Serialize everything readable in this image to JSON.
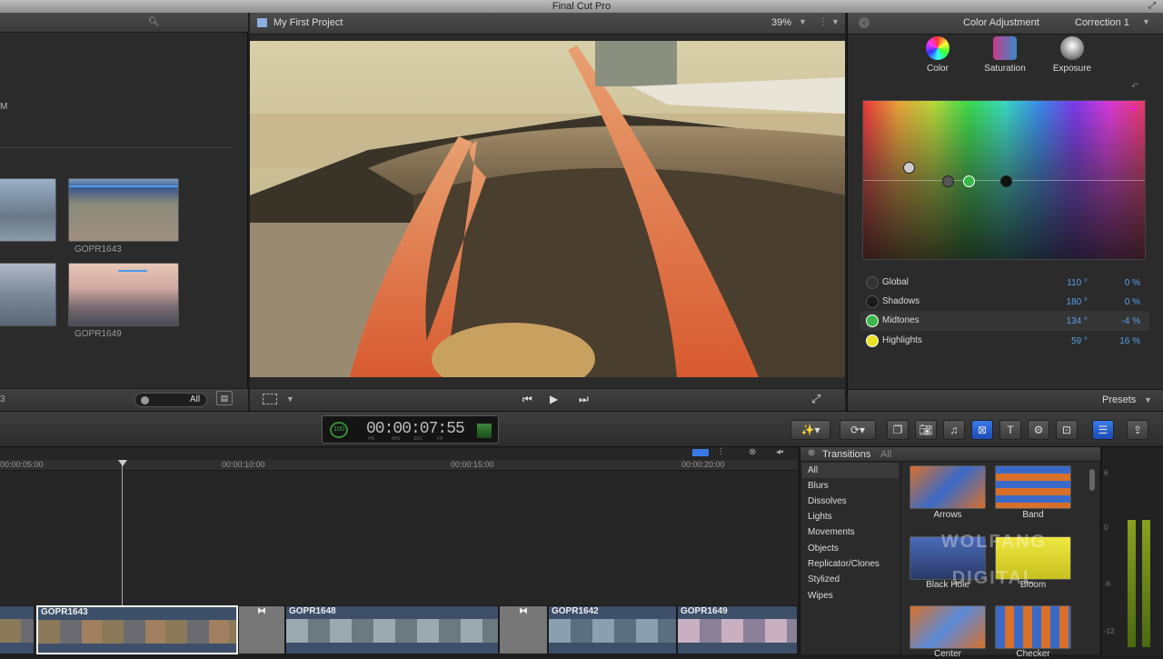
{
  "app": {
    "title": "Final Cut Pro"
  },
  "browser": {
    "search_icon": "search-icon",
    "clips": [
      {
        "label": ""
      },
      {
        "label": "GOPR1643"
      },
      {
        "label": ""
      },
      {
        "label": "GOPR1649"
      }
    ],
    "count_text": "3",
    "left_letter": "M",
    "filter_label": "All"
  },
  "viewer": {
    "project_title": "My First Project",
    "zoom": "39%",
    "icons": [
      "film-icon",
      "rewind-icon",
      "play-icon",
      "forward-icon",
      "fullscreen-icon",
      "crop-icon"
    ]
  },
  "inspector": {
    "title": "Color Adjustment",
    "correction": "Correction 1",
    "tools": [
      {
        "label": "Color",
        "icon": "color-wheel-icon"
      },
      {
        "label": "Saturation",
        "icon": "saturation-icon"
      },
      {
        "label": "Exposure",
        "icon": "exposure-icon"
      }
    ],
    "rows": [
      {
        "name": "Global",
        "angle": "110 °",
        "amount": "0 %",
        "color": "#333333"
      },
      {
        "name": "Shadows",
        "angle": "180 °",
        "amount": "0 %",
        "color": "#1a1a1a"
      },
      {
        "name": "Midtones",
        "angle": "134 °",
        "amount": "-4 %",
        "color": "#3ab84a"
      },
      {
        "name": "Highlights",
        "angle": "59 °",
        "amount": "16 %",
        "color": "#e8e020"
      }
    ],
    "presets_label": "Presets"
  },
  "toolbar": {
    "timecode": "00:00:07:55",
    "timecode_units": [
      "HR",
      "MIN",
      "SEC",
      "FR"
    ],
    "speed": "100"
  },
  "timeline": {
    "ticks": [
      "00:00:05:00",
      "00:00:10:00",
      "00:00:15:00",
      "00:00:20:00"
    ],
    "clips": [
      {
        "name": "GOPR1643"
      },
      {
        "name": "GOPR1648"
      },
      {
        "name": "GOPR1642"
      },
      {
        "name": "GOPR1649"
      }
    ]
  },
  "transitions": {
    "title": "Transitions",
    "filter": "All",
    "categories": [
      "All",
      "Blurs",
      "Dissolves",
      "Lights",
      "Movements",
      "Objects",
      "Replicator/Clones",
      "Stylized",
      "Wipes"
    ],
    "items": [
      {
        "name": "Arrows"
      },
      {
        "name": "Band"
      },
      {
        "name": "Black Hole"
      },
      {
        "name": "Bloom"
      },
      {
        "name": "Center"
      },
      {
        "name": "Checker"
      }
    ]
  },
  "meters": {
    "labels": [
      "6",
      "0",
      "-6",
      "-12"
    ]
  },
  "watermark": "WOLFANG DIGITAL"
}
